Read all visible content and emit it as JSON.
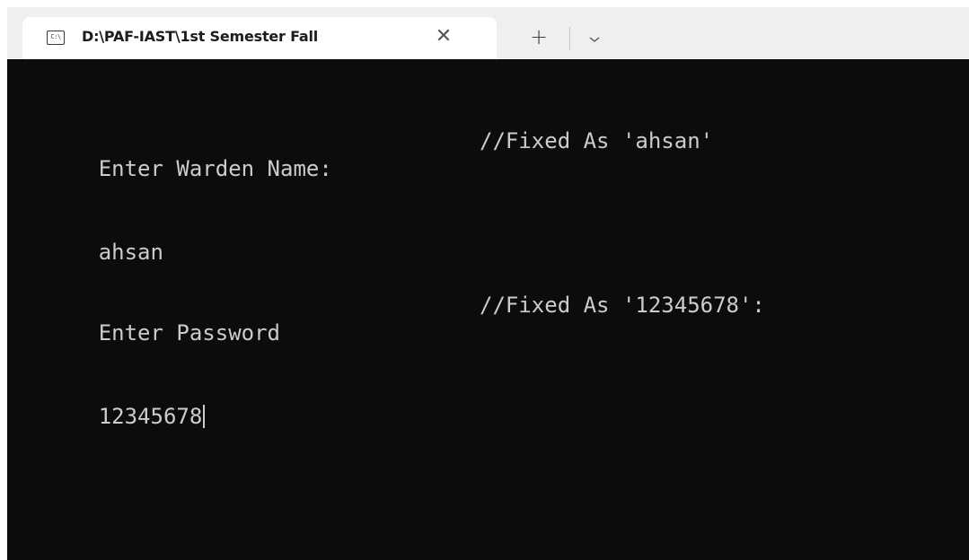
{
  "tab": {
    "icon_text": "C:\\",
    "title": "D:\\PAF-IAST\\1st Semester Fall",
    "close_glyph": "✕"
  },
  "toolbar": {
    "new_tab_glyph": "+",
    "dropdown_icon": "chevron-down-icon"
  },
  "terminal": {
    "lines": [
      {
        "prompt": "Enter Warden Name:",
        "comment": "//Fixed As 'ahsan'"
      },
      {
        "input": "ahsan"
      },
      {
        "prompt": "Enter Password",
        "comment": "//Fixed As '12345678':"
      },
      {
        "input": "12345678"
      }
    ]
  },
  "colors": {
    "terminal_bg": "#0c0c0c",
    "terminal_fg": "#cccccc",
    "tabbar_bg": "#efefef",
    "tab_bg": "#ffffff"
  }
}
